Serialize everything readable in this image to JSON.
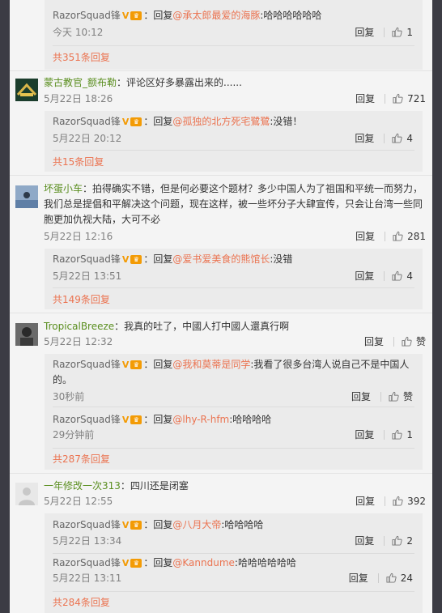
{
  "common": {
    "reply": "回复",
    "reply_prefix": "回复",
    "v": "V"
  },
  "top": {
    "user": "RazorSquad锋",
    "at": "@承太郎最爱的海豚",
    "text": ":哈哈哈哈哈哈",
    "time": "今天 10:12",
    "likes": "1",
    "more": "共351条回复"
  },
  "threads": [
    {
      "user": "蒙古教官_额布勒",
      "text": "：评论区好多暴露出来的......",
      "time": "5月22日 18:26",
      "likes": "721",
      "reply": {
        "user": "RazorSquad锋",
        "at": "@孤独的北方死宅鷺鷺",
        "text": ":没错！",
        "time": "5月22日 20:12",
        "likes": "4"
      },
      "more": "共15条回复"
    },
    {
      "user": "坏蛋小车",
      "text": "：拍得确实不错，但是何必要这个题材？多少中国人为了祖国和平统一而努力，我们总是提倡和平解决这个问题，现在这样，被一些坏分子大肆宣传，只会让台湾一些同胞更加仇视大陆，大可不必",
      "time": "5月22日 12:16",
      "likes": "281",
      "reply": {
        "user": "RazorSquad锋",
        "at": "@爱书爱美食的熊馆长",
        "text": ":没错",
        "time": "5月22日 13:51",
        "likes": "4"
      },
      "more": "共149条回复"
    },
    {
      "user": "TropicalBreeze",
      "text": "：我真的吐了，中國人打中國人還真行啊",
      "time": "5月22日 12:32",
      "likes": "赞",
      "replies": [
        {
          "user": "RazorSquad锋",
          "at": "@我和莫蒂是同学",
          "text": ":我看了很多台湾人说自己不是中国人的。",
          "time": "30秒前",
          "likes": "赞"
        },
        {
          "user": "RazorSquad锋",
          "at": "@lhy-R-hfm",
          "text": ":哈哈哈哈",
          "time": "29分钟前",
          "likes": "1"
        }
      ],
      "more": "共287条回复"
    },
    {
      "user": "一年修改一次313",
      "text": "：四川还是闭塞",
      "time": "5月22日 12:55",
      "likes": "392",
      "replies": [
        {
          "user": "RazorSquad锋",
          "at": "@八月大帝",
          "text": ":哈哈哈哈",
          "time": "5月22日 13:34",
          "likes": "2"
        },
        {
          "user": "RazorSquad锋",
          "at": "@Kanndume",
          "text": ":哈哈哈哈哈哈",
          "time": "5月22日 13:11",
          "likes": "24"
        }
      ],
      "more": "共284条回复"
    }
  ]
}
